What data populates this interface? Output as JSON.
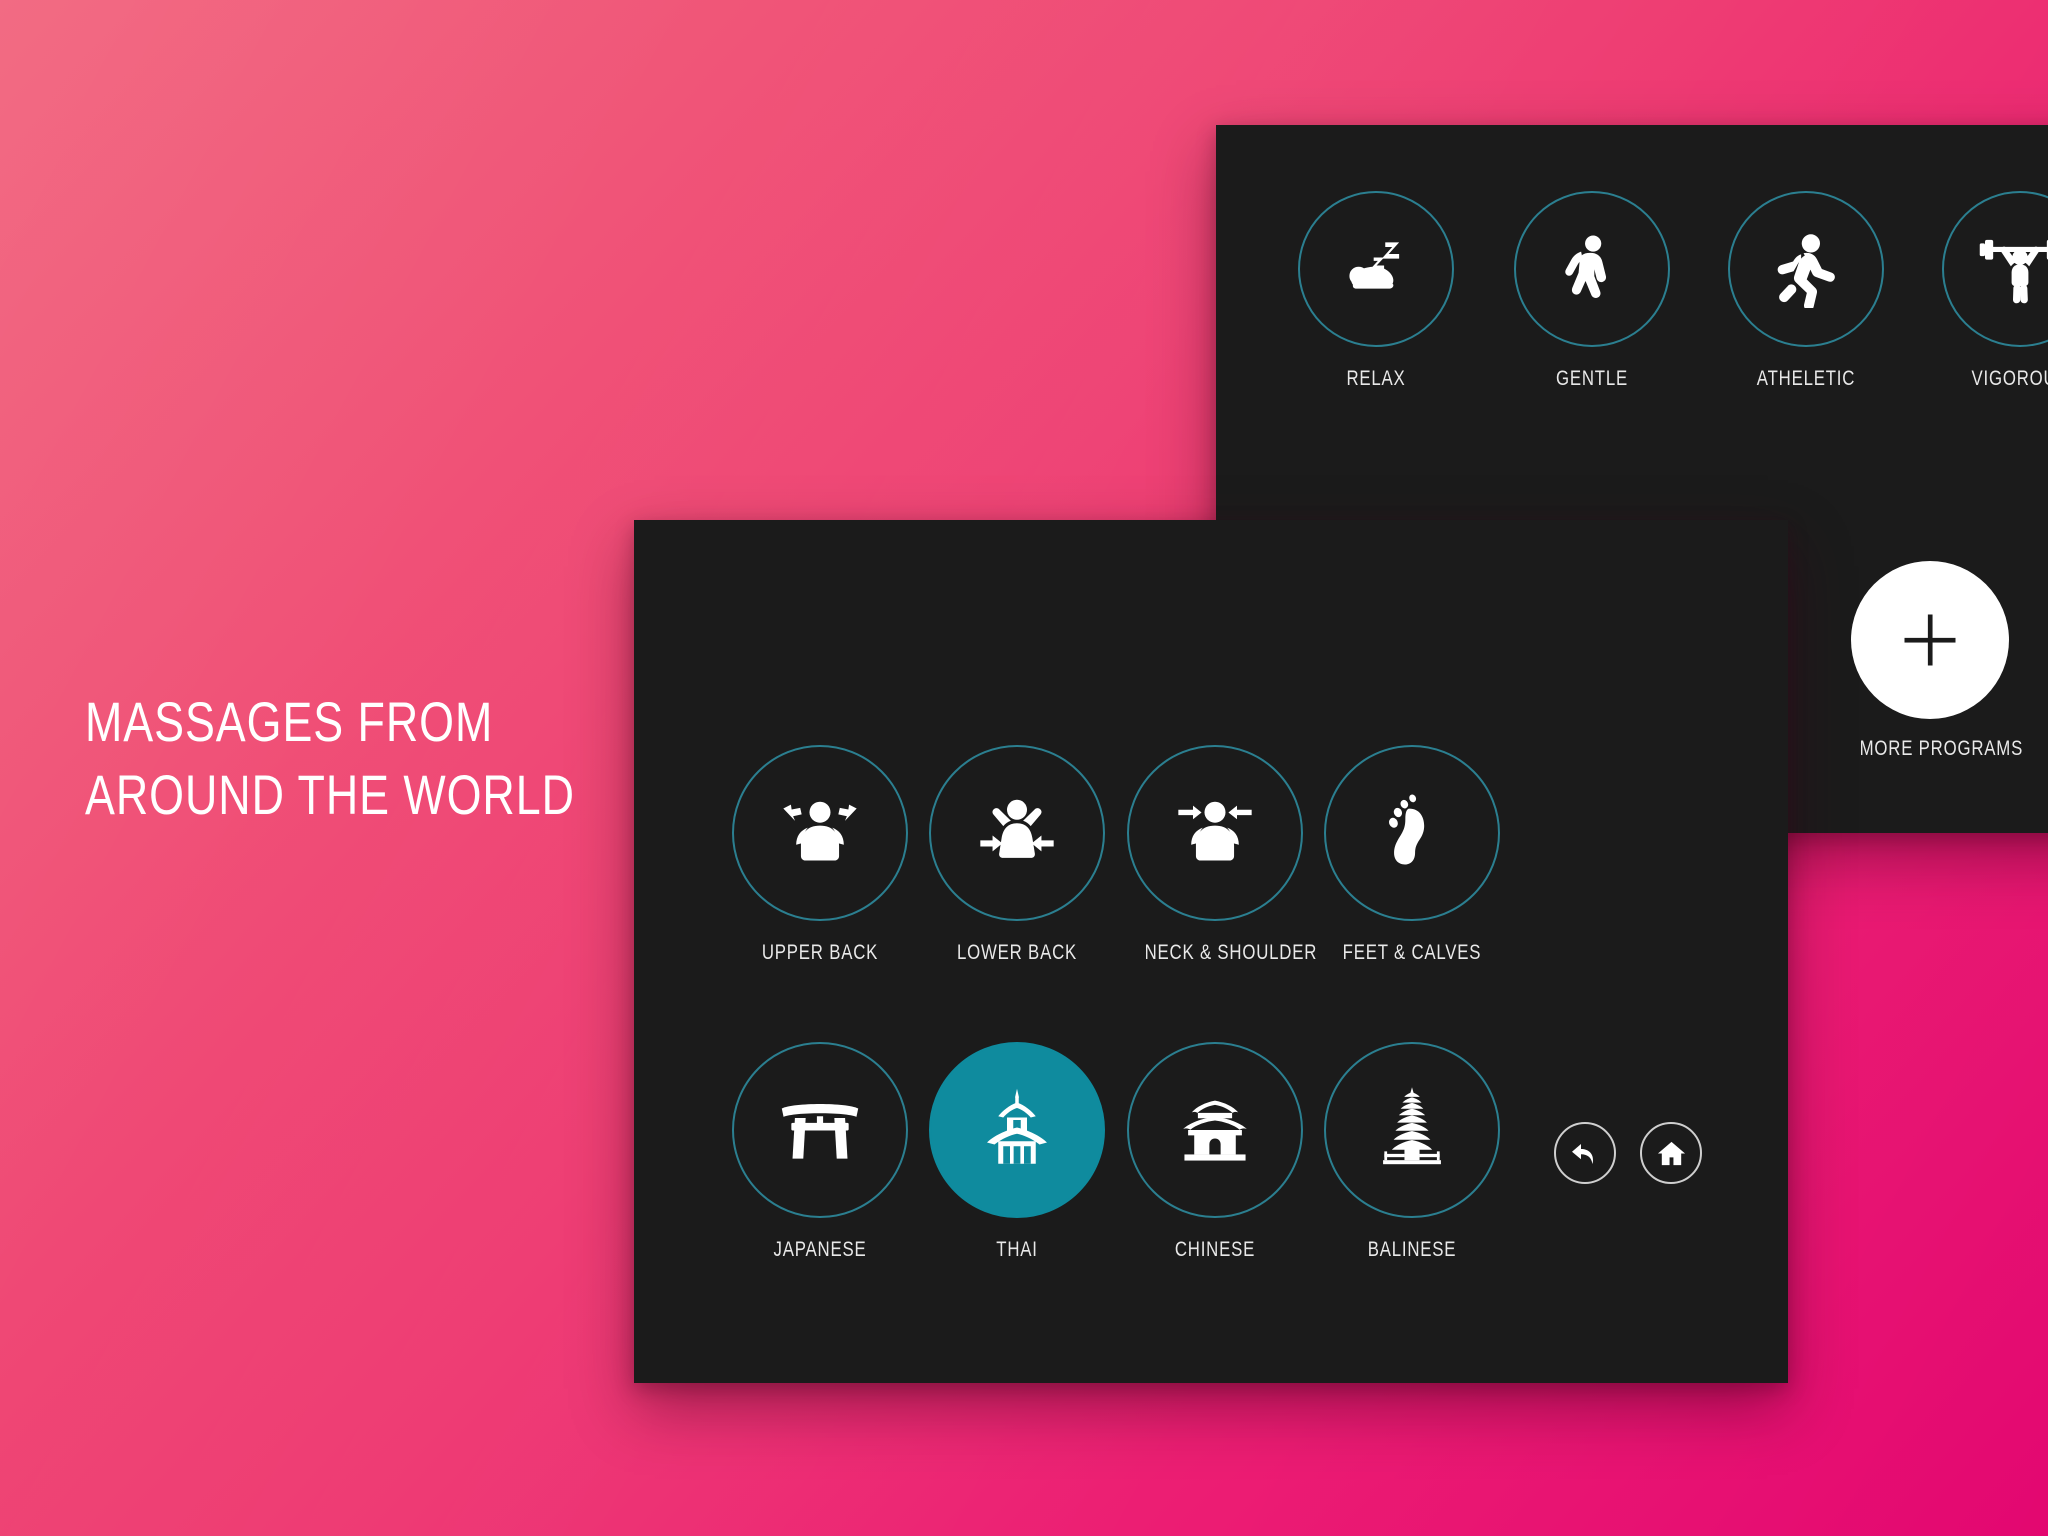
{
  "headline": {
    "line1": "MASSAGES FROM",
    "line2": "AROUND THE WORLD"
  },
  "theme": {
    "bg_gradient_start": "#f2667f",
    "bg_gradient_end": "#ea0774",
    "panel_bg": "#1b1b1b",
    "ring_stroke": "#2b7f90",
    "accent_selected": "#0f8b9e",
    "label_color": "#e9e9e9",
    "white": "#ffffff"
  },
  "programs_panel": {
    "tiles": [
      {
        "label": "RELAX",
        "icon": "sleeping-person-icon",
        "selected": false
      },
      {
        "label": "GENTLE",
        "icon": "walking-person-icon",
        "selected": false
      },
      {
        "label": "ATHELETIC",
        "icon": "running-person-icon",
        "selected": false
      },
      {
        "label": "VIGOROUS",
        "icon": "weightlifter-icon",
        "selected": false
      }
    ],
    "more": {
      "label": "MORE PROGRAMS",
      "icon": "plus-icon"
    }
  },
  "massages_panel": {
    "nav": [
      {
        "name": "back-button",
        "icon": "back-arrow-icon"
      },
      {
        "name": "home-button",
        "icon": "home-icon"
      }
    ],
    "row1": [
      {
        "label": "UPPER BACK",
        "icon": "upper-back-icon",
        "selected": false
      },
      {
        "label": "LOWER BACK",
        "icon": "lower-back-icon",
        "selected": false
      },
      {
        "label": "NECK & SHOULDER",
        "icon": "neck-shoulder-icon",
        "selected": false
      },
      {
        "label": "FEET & CALVES",
        "icon": "footprint-icon",
        "selected": false
      }
    ],
    "row2": [
      {
        "label": "JAPANESE",
        "icon": "torii-gate-icon",
        "selected": false
      },
      {
        "label": "THAI",
        "icon": "thai-temple-icon",
        "selected": true
      },
      {
        "label": "CHINESE",
        "icon": "chinese-temple-icon",
        "selected": false
      },
      {
        "label": "BALINESE",
        "icon": "balinese-pagoda-icon",
        "selected": false
      }
    ]
  }
}
